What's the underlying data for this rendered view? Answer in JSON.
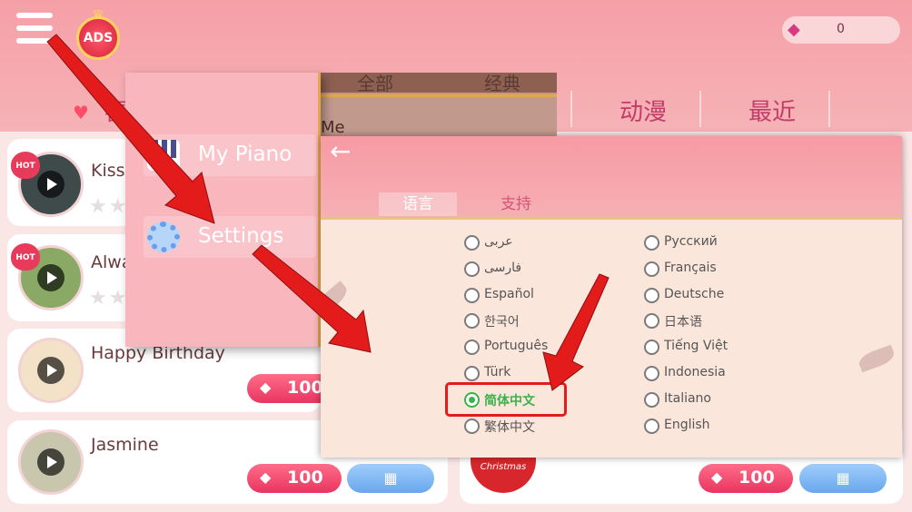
{
  "header": {
    "ads_label": "ADS",
    "gem_count": "0",
    "tabs": [
      "喜",
      "动漫",
      "最近"
    ]
  },
  "back_panel": {
    "tabs": [
      "全部",
      "经典"
    ],
    "me_text": "Me"
  },
  "side_menu": {
    "items": [
      {
        "label": "My Piano",
        "icon": "piano-icon"
      },
      {
        "label": "Settings",
        "icon": "gear-icon"
      }
    ]
  },
  "songs": [
    {
      "title": "Kiss",
      "hot": "HOT"
    },
    {
      "title": "Alwa",
      "hot": "HOT"
    },
    {
      "title": "Happy Birthday",
      "price": "100"
    },
    {
      "title": "Jasmine",
      "price": "100",
      "video_icon": "film-icon"
    }
  ],
  "right_card": {
    "price": "100",
    "thumb_text": "Christmas",
    "video_icon": "film-icon"
  },
  "settings": {
    "tabs": [
      "语言",
      "支持"
    ],
    "active_tab": "语言",
    "languages_left": [
      "عربى",
      "فارسی",
      "Español",
      "한국어",
      "Português",
      "Türk",
      "简体中文",
      "繁体中文"
    ],
    "languages_right": [
      "Русский",
      "Français",
      "Deutsche",
      "日本语",
      "Tiếng Việt",
      "Indonesia",
      "Italiano",
      "English"
    ],
    "selected": "简体中文"
  },
  "colors": {
    "header": "#f69fa7",
    "accent_red": "#e31b1b",
    "selected_green": "#3db24c"
  }
}
